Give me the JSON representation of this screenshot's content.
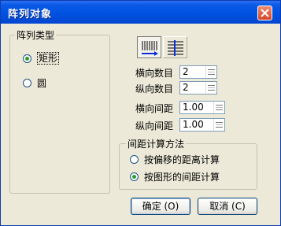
{
  "dialog": {
    "title": "阵列对象"
  },
  "array_type": {
    "label": "阵列类型",
    "options": [
      {
        "label": "矩形",
        "checked": true
      },
      {
        "label": "圆",
        "checked": false
      }
    ]
  },
  "mode_buttons": [
    "columns-icon",
    "rows-icon"
  ],
  "fields": {
    "h_count": {
      "label": "横向数目",
      "value": "2"
    },
    "v_count": {
      "label": "纵向数目",
      "value": "2"
    },
    "h_spacing": {
      "label": "横向间距",
      "value": "1.00"
    },
    "v_spacing": {
      "label": "纵向间距",
      "value": "1.00"
    }
  },
  "spacing_method": {
    "label": "间距计算方法",
    "options": [
      {
        "label": "按偏移的距离计算",
        "checked": false
      },
      {
        "label": "按图形的间距计算",
        "checked": true
      }
    ]
  },
  "buttons": {
    "ok": "确定 (O)",
    "cancel": "取消 (C)"
  },
  "colors": {
    "titlebar": "#0054e3",
    "close": "#d2452b",
    "face": "#ece9d8"
  }
}
